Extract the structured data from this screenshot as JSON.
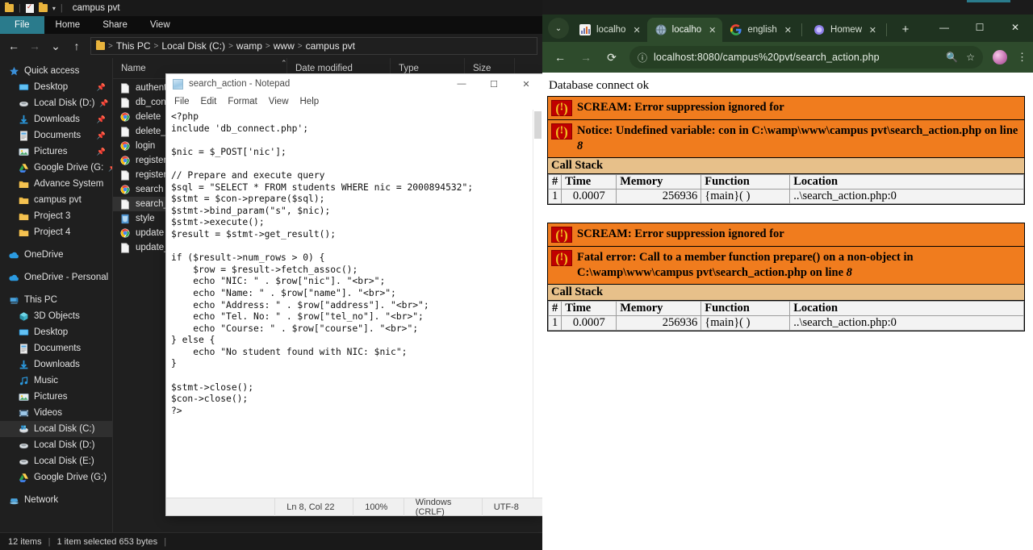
{
  "explorer": {
    "quick_access_toolbar": {
      "folder_icon": "folder-icon",
      "properties_icon": "properties-icon",
      "new_folder_icon": "new-folder-icon",
      "customize_caret": "▾",
      "title": "campus pvt"
    },
    "ribbon_tabs": [
      {
        "label": "File",
        "active": true
      },
      {
        "label": "Home",
        "active": false
      },
      {
        "label": "Share",
        "active": false
      },
      {
        "label": "View",
        "active": false
      }
    ],
    "address_bar": {
      "back": "←",
      "forward": "→",
      "recent": "⌄",
      "up": "↑",
      "breadcrumbs": [
        "This PC",
        "Local Disk (C:)",
        "wamp",
        "www",
        "campus pvt"
      ]
    },
    "nav_pane": [
      {
        "label": "Quick access",
        "icon": "star-icon",
        "indent": false,
        "pin": false,
        "selected": false
      },
      {
        "label": "Desktop",
        "icon": "desktop-icon",
        "indent": true,
        "pin": true,
        "selected": false
      },
      {
        "label": "Local Disk (D:)",
        "icon": "drive-icon",
        "indent": true,
        "pin": true,
        "selected": false
      },
      {
        "label": "Downloads",
        "icon": "download-icon",
        "indent": true,
        "pin": true,
        "selected": false
      },
      {
        "label": "Documents",
        "icon": "documents-icon",
        "indent": true,
        "pin": true,
        "selected": false
      },
      {
        "label": "Pictures",
        "icon": "pictures-icon",
        "indent": true,
        "pin": true,
        "selected": false
      },
      {
        "label": "Google Drive (G:",
        "icon": "google-drive-icon",
        "indent": true,
        "pin": true,
        "selected": false
      },
      {
        "label": "Advance System",
        "icon": "folder-icon",
        "indent": true,
        "pin": false,
        "selected": false
      },
      {
        "label": "campus pvt",
        "icon": "folder-icon",
        "indent": true,
        "pin": false,
        "selected": false
      },
      {
        "label": "Project 3",
        "icon": "folder-icon",
        "indent": true,
        "pin": false,
        "selected": false
      },
      {
        "label": "Project 4",
        "icon": "folder-icon",
        "indent": true,
        "pin": false,
        "selected": false
      },
      {
        "label": "OneDrive",
        "icon": "onedrive-icon",
        "indent": false,
        "pin": false,
        "selected": false,
        "gap_before": true
      },
      {
        "label": "OneDrive - Personal",
        "icon": "onedrive-icon",
        "indent": false,
        "pin": false,
        "selected": false,
        "gap_before": true
      },
      {
        "label": "This PC",
        "icon": "this-pc-icon",
        "indent": false,
        "pin": false,
        "selected": false,
        "gap_before": true
      },
      {
        "label": "3D Objects",
        "icon": "3d-objects-icon",
        "indent": true,
        "pin": false,
        "selected": false
      },
      {
        "label": "Desktop",
        "icon": "desktop-icon",
        "indent": true,
        "pin": false,
        "selected": false
      },
      {
        "label": "Documents",
        "icon": "documents-icon",
        "indent": true,
        "pin": false,
        "selected": false
      },
      {
        "label": "Downloads",
        "icon": "download-icon",
        "indent": true,
        "pin": false,
        "selected": false
      },
      {
        "label": "Music",
        "icon": "music-icon",
        "indent": true,
        "pin": false,
        "selected": false
      },
      {
        "label": "Pictures",
        "icon": "pictures-icon",
        "indent": true,
        "pin": false,
        "selected": false
      },
      {
        "label": "Videos",
        "icon": "videos-icon",
        "indent": true,
        "pin": false,
        "selected": false
      },
      {
        "label": "Local Disk (C:)",
        "icon": "windows-drive-icon",
        "indent": true,
        "pin": false,
        "selected": true
      },
      {
        "label": "Local Disk (D:)",
        "icon": "drive-icon",
        "indent": true,
        "pin": false,
        "selected": false
      },
      {
        "label": "Local Disk (E:)",
        "icon": "drive-icon",
        "indent": true,
        "pin": false,
        "selected": false
      },
      {
        "label": "Google Drive (G:)",
        "icon": "google-drive-icon",
        "indent": true,
        "pin": false,
        "selected": false
      },
      {
        "label": "Network",
        "icon": "network-icon",
        "indent": false,
        "pin": false,
        "selected": false,
        "gap_before": true
      }
    ],
    "columns": [
      "Name",
      "Date modified",
      "Type",
      "Size"
    ],
    "files": [
      {
        "name": "authentic",
        "icon": "file-icon",
        "selected": false
      },
      {
        "name": "db_conne",
        "icon": "file-icon",
        "selected": false
      },
      {
        "name": "delete",
        "icon": "chrome-icon",
        "selected": false
      },
      {
        "name": "delete_ac",
        "icon": "file-icon",
        "selected": false
      },
      {
        "name": "login",
        "icon": "chrome-icon",
        "selected": false
      },
      {
        "name": "register",
        "icon": "chrome-icon",
        "selected": false
      },
      {
        "name": "register_a",
        "icon": "file-icon",
        "selected": false
      },
      {
        "name": "search",
        "icon": "chrome-icon",
        "selected": false
      },
      {
        "name": "search_ac",
        "icon": "file-icon",
        "selected": true
      },
      {
        "name": "style",
        "icon": "css-icon",
        "selected": false
      },
      {
        "name": "update",
        "icon": "chrome-icon",
        "selected": false
      },
      {
        "name": "update_a",
        "icon": "file-icon",
        "selected": false
      }
    ],
    "status": {
      "items_count": "12 items",
      "divider": "|",
      "selection": "1 item selected  653 bytes",
      "trailing_divider": "|"
    }
  },
  "notepad": {
    "title": "search_action - Notepad",
    "window_controls": {
      "minimize": "—",
      "maximize": "☐",
      "close": "✕"
    },
    "menu": [
      "File",
      "Edit",
      "Format",
      "View",
      "Help"
    ],
    "content": "<?php\ninclude 'db_connect.php';\n\n$nic = $_POST['nic'];\n\n// Prepare and execute query\n$sql = \"SELECT * FROM students WHERE nic = 2000894532\";\n$stmt = $con->prepare($sql);\n$stmt->bind_param(\"s\", $nic);\n$stmt->execute();\n$result = $stmt->get_result();\n\nif ($result->num_rows > 0) {\n    $row = $result->fetch_assoc();\n    echo \"NIC: \" . $row[\"nic\"]. \"<br>\";\n    echo \"Name: \" . $row[\"name\"]. \"<br>\";\n    echo \"Address: \" . $row[\"address\"]. \"<br>\";\n    echo \"Tel. No: \" . $row[\"tel_no\"]. \"<br>\";\n    echo \"Course: \" . $row[\"course\"]. \"<br>\";\n} else {\n    echo \"No student found with NIC: $nic\";\n}\n\n$stmt->close();\n$con->close();\n?>",
    "status": {
      "cursor": "Ln 8, Col 22",
      "zoom": "100%",
      "line_ending": "Windows (CRLF)",
      "encoding": "UTF-8"
    }
  },
  "browser": {
    "tab_list_caret": "⌄",
    "tabs": [
      {
        "label": "localho",
        "favicon": "phpmyadmin-icon",
        "active": false
      },
      {
        "label": "localho",
        "favicon": "globe-icon",
        "active": true
      },
      {
        "label": "english",
        "favicon": "google-icon",
        "active": false
      },
      {
        "label": "Homew",
        "favicon": "copilot-icon",
        "active": false
      }
    ],
    "new_tab": "+",
    "window_controls": {
      "minimize": "—",
      "maximize": "☐",
      "close": "✕"
    },
    "toolbar": {
      "back": "←",
      "forward": "→",
      "reload": "⟳",
      "site_info_icon": "info-circle-icon",
      "url": "localhost:8080/campus%20pvt/search_action.php",
      "zoom_icon": "zoom-icon",
      "bookmark_icon": "star-icon",
      "profile_icon": "avatar-icon",
      "menu_icon": "kebab-menu-icon"
    },
    "page": {
      "db_message": "Database connect ok",
      "error_blocks": [
        {
          "scream": "SCREAM: Error suppression ignored for",
          "message_prefix": "Notice: Undefined variable: con in C:\\wamp\\www\\campus pvt\\search_action.php on line ",
          "message_line": "8",
          "call_stack_title": "Call Stack",
          "columns": [
            "#",
            "Time",
            "Memory",
            "Function",
            "Location"
          ],
          "rows": [
            {
              "num": "1",
              "time": "0.0007",
              "memory": "256936",
              "function": "{main}( )",
              "location": "..\\search_action.php:0"
            }
          ]
        },
        {
          "scream": "SCREAM: Error suppression ignored for",
          "message_prefix": "Fatal error: Call to a member function prepare() on a non-object in C:\\wamp\\www\\campus pvt\\search_action.php on line ",
          "message_line": "8",
          "call_stack_title": "Call Stack",
          "columns": [
            "#",
            "Time",
            "Memory",
            "Function",
            "Location"
          ],
          "rows": [
            {
              "num": "1",
              "time": "0.0007",
              "memory": "256936",
              "function": "{main}( )",
              "location": "..\\search_action.php:0"
            }
          ]
        }
      ]
    }
  },
  "desktop": {
    "help_badge": "?",
    "search_icon": "search-icon"
  },
  "colors": {
    "explorer_bg": "#1f1f1f",
    "ribbon_file_tab": "#2a7b8c",
    "browser_chrome": "#2e4b2c",
    "error_orange": "#f07c1e",
    "callstack_tan": "#e7c08a",
    "error_icon_red": "#c00000",
    "error_icon_yellow": "#f0c020",
    "selection_gray": "#323232"
  }
}
